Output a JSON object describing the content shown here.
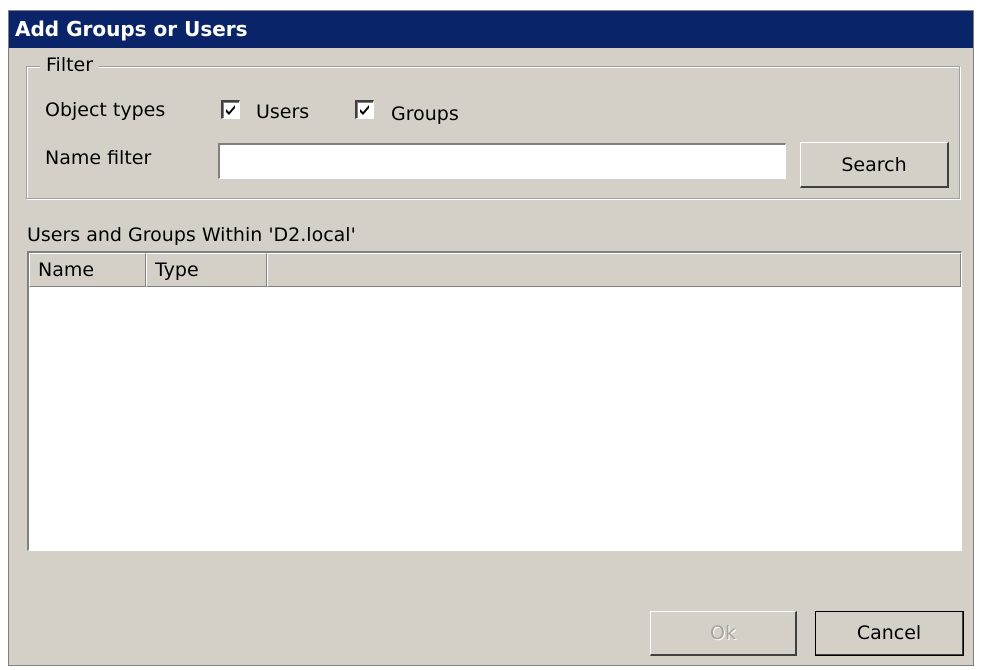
{
  "window": {
    "title": "Add Groups or Users"
  },
  "filter": {
    "legend": "Filter",
    "object_types_label": "Object types",
    "users_checkbox": {
      "label": "Users",
      "checked": true
    },
    "groups_checkbox": {
      "label": "Groups",
      "checked": true
    },
    "name_filter_label": "Name filter",
    "name_filter_value": "",
    "search_button": "Search"
  },
  "results": {
    "label": "Users and Groups Within 'D2.local'",
    "columns": [
      "Name",
      "Type"
    ],
    "rows": []
  },
  "footer": {
    "ok_button": "Ok",
    "ok_enabled": false,
    "cancel_button": "Cancel"
  }
}
